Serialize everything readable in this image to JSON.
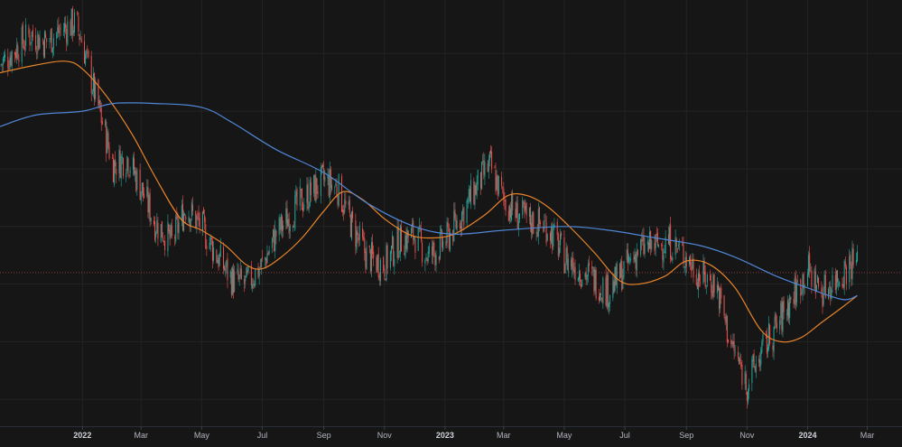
{
  "chart_data": {
    "type": "candlestick",
    "x_tick_labels": [
      {
        "label": "2022",
        "date": "2022-01-01",
        "major": true
      },
      {
        "label": "Mar",
        "date": "2022-03-01",
        "major": false
      },
      {
        "label": "May",
        "date": "2022-05-01",
        "major": false
      },
      {
        "label": "Jul",
        "date": "2022-07-01",
        "major": false
      },
      {
        "label": "Sep",
        "date": "2022-09-01",
        "major": false
      },
      {
        "label": "Nov",
        "date": "2022-11-01",
        "major": false
      },
      {
        "label": "2023",
        "date": "2023-01-01",
        "major": true
      },
      {
        "label": "Mar",
        "date": "2023-03-01",
        "major": false
      },
      {
        "label": "May",
        "date": "2023-05-01",
        "major": false
      },
      {
        "label": "Jul",
        "date": "2023-07-01",
        "major": false
      },
      {
        "label": "Sep",
        "date": "2023-09-01",
        "major": false
      },
      {
        "label": "Nov",
        "date": "2023-11-01",
        "major": false
      },
      {
        "label": "2024",
        "date": "2024-01-01",
        "major": true
      },
      {
        "label": "Mar",
        "date": "2024-03-01",
        "major": false
      }
    ],
    "x_range": [
      "2021-10-10",
      "2024-04-05"
    ],
    "y_range": [
      78,
      188
    ],
    "gridlines": true,
    "price_level": 118,
    "series": [
      {
        "kind": "moving_average",
        "color": "#e8842a",
        "points": [
          [
            "2021-10-10",
            170
          ],
          [
            "2021-11-15",
            172
          ],
          [
            "2021-12-15",
            173
          ],
          [
            "2022-01-01",
            171
          ],
          [
            "2022-01-25",
            164
          ],
          [
            "2022-02-20",
            154
          ],
          [
            "2022-03-15",
            143
          ],
          [
            "2022-04-10",
            132
          ],
          [
            "2022-05-01",
            129
          ],
          [
            "2022-05-25",
            125
          ],
          [
            "2022-06-15",
            120
          ],
          [
            "2022-07-01",
            119
          ],
          [
            "2022-07-20",
            122
          ],
          [
            "2022-08-10",
            127
          ],
          [
            "2022-09-01",
            134
          ],
          [
            "2022-09-20",
            139
          ],
          [
            "2022-10-10",
            137
          ],
          [
            "2022-11-01",
            132
          ],
          [
            "2022-11-25",
            128
          ],
          [
            "2022-12-15",
            127
          ],
          [
            "2023-01-10",
            128
          ],
          [
            "2023-02-10",
            133
          ],
          [
            "2023-03-05",
            138
          ],
          [
            "2023-03-25",
            138
          ],
          [
            "2023-04-15",
            135
          ],
          [
            "2023-05-10",
            129
          ],
          [
            "2023-06-01",
            123
          ],
          [
            "2023-06-25",
            116
          ],
          [
            "2023-07-15",
            115
          ],
          [
            "2023-08-10",
            117
          ],
          [
            "2023-09-01",
            121
          ],
          [
            "2023-09-25",
            120
          ],
          [
            "2023-10-20",
            114
          ],
          [
            "2023-11-15",
            103
          ],
          [
            "2023-12-05",
            100
          ],
          [
            "2023-12-25",
            101
          ],
          [
            "2024-01-15",
            105
          ],
          [
            "2024-02-05",
            109
          ],
          [
            "2024-02-20",
            112
          ]
        ]
      },
      {
        "kind": "moving_average",
        "color": "#4f86d6",
        "points": [
          [
            "2021-10-10",
            156
          ],
          [
            "2021-11-15",
            159
          ],
          [
            "2022-01-01",
            160
          ],
          [
            "2022-02-01",
            162
          ],
          [
            "2022-03-15",
            162
          ],
          [
            "2022-05-01",
            161
          ],
          [
            "2022-06-01",
            157
          ],
          [
            "2022-07-15",
            150
          ],
          [
            "2022-09-01",
            144
          ],
          [
            "2022-10-15",
            136
          ],
          [
            "2022-12-01",
            130
          ],
          [
            "2023-01-10",
            128
          ],
          [
            "2023-03-01",
            129
          ],
          [
            "2023-05-01",
            130
          ],
          [
            "2023-06-15",
            129
          ],
          [
            "2023-08-01",
            127
          ],
          [
            "2023-09-15",
            125
          ],
          [
            "2023-10-20",
            122
          ],
          [
            "2023-12-01",
            117
          ],
          [
            "2024-01-01",
            114
          ],
          [
            "2024-02-05",
            111
          ],
          [
            "2024-02-20",
            112
          ]
        ]
      },
      {
        "kind": "candles",
        "up_color": "#26a69a",
        "down_color": "#ef5350",
        "closes": [
          [
            "2021-10-10",
            172
          ],
          [
            "2021-10-25",
            176
          ],
          [
            "2021-11-10",
            180
          ],
          [
            "2021-11-25",
            178
          ],
          [
            "2021-12-10",
            181
          ],
          [
            "2021-12-25",
            183
          ],
          [
            "2022-01-01",
            178
          ],
          [
            "2022-01-10",
            168
          ],
          [
            "2022-01-20",
            158
          ],
          [
            "2022-02-01",
            146
          ],
          [
            "2022-02-15",
            148
          ],
          [
            "2022-03-01",
            140
          ],
          [
            "2022-03-15",
            131
          ],
          [
            "2022-04-01",
            126
          ],
          [
            "2022-04-15",
            135
          ],
          [
            "2022-05-01",
            130
          ],
          [
            "2022-05-15",
            123
          ],
          [
            "2022-06-01",
            116
          ],
          [
            "2022-06-15",
            115
          ],
          [
            "2022-07-01",
            120
          ],
          [
            "2022-07-15",
            128
          ],
          [
            "2022-08-01",
            134
          ],
          [
            "2022-08-15",
            138
          ],
          [
            "2022-09-01",
            142
          ],
          [
            "2022-09-15",
            140
          ],
          [
            "2022-10-01",
            129
          ],
          [
            "2022-10-15",
            122
          ],
          [
            "2022-11-01",
            120
          ],
          [
            "2022-11-15",
            126
          ],
          [
            "2022-12-01",
            128
          ],
          [
            "2022-12-15",
            122
          ],
          [
            "2023-01-01",
            126
          ],
          [
            "2023-01-15",
            132
          ],
          [
            "2023-02-01",
            140
          ],
          [
            "2023-02-15",
            146
          ],
          [
            "2023-03-01",
            137
          ],
          [
            "2023-03-15",
            133
          ],
          [
            "2023-04-01",
            131
          ],
          [
            "2023-04-15",
            130
          ],
          [
            "2023-05-01",
            122
          ],
          [
            "2023-05-15",
            119
          ],
          [
            "2023-06-01",
            116
          ],
          [
            "2023-06-15",
            113
          ],
          [
            "2023-07-01",
            119
          ],
          [
            "2023-07-15",
            124
          ],
          [
            "2023-08-01",
            125
          ],
          [
            "2023-08-15",
            126
          ],
          [
            "2023-09-01",
            122
          ],
          [
            "2023-09-15",
            117
          ],
          [
            "2023-10-01",
            115
          ],
          [
            "2023-10-15",
            100
          ],
          [
            "2023-11-01",
            89
          ],
          [
            "2023-11-15",
            97
          ],
          [
            "2023-12-01",
            104
          ],
          [
            "2023-12-15",
            111
          ],
          [
            "2024-01-01",
            119
          ],
          [
            "2024-01-15",
            113
          ],
          [
            "2024-02-01",
            117
          ],
          [
            "2024-02-15",
            121
          ],
          [
            "2024-02-20",
            120
          ]
        ]
      }
    ]
  }
}
